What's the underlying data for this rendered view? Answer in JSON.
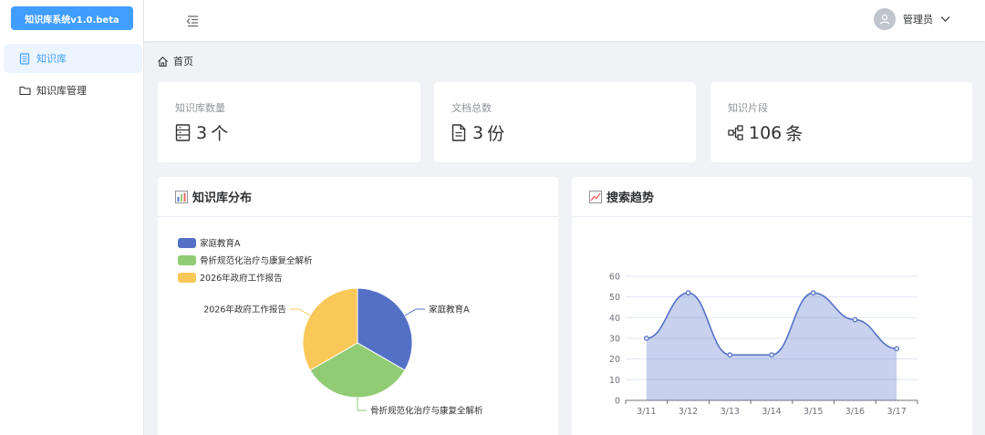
{
  "app": {
    "title": "知识库系统v1.0.beta"
  },
  "sidebar": {
    "items": [
      {
        "label": "知识库",
        "active": true
      },
      {
        "label": "知识库管理",
        "active": false
      }
    ]
  },
  "header": {
    "user_name": "管理员"
  },
  "breadcrumb": {
    "home_label": "首页"
  },
  "stats": [
    {
      "label": "知识库数量",
      "value": "3",
      "unit": "个",
      "icon": "document-list-icon"
    },
    {
      "label": "文档总数",
      "value": "3",
      "unit": "份",
      "icon": "file-text-icon"
    },
    {
      "label": "知识片段",
      "value": "106",
      "unit": "条",
      "icon": "node-tree-icon"
    }
  ],
  "colors": {
    "accent": "#409eff",
    "blue": "#5470c6",
    "green": "#91cc75",
    "yellow": "#fac858"
  },
  "pie_panel": {
    "title": "知识库分布"
  },
  "line_panel": {
    "title": "搜索趋势"
  },
  "chart_data": [
    {
      "type": "pie",
      "title": "知识库分布",
      "legend_position": "top-left",
      "categories": [
        "家庭教育A",
        "骨折规范化治疗与康复全解析",
        "2026年政府工作报告"
      ],
      "values": [
        1,
        1,
        1
      ],
      "colors": [
        "#5470c6",
        "#91cc75",
        "#fac858"
      ]
    },
    {
      "type": "area",
      "title": "搜索趋势",
      "x": [
        "3/11",
        "3/12",
        "3/13",
        "3/14",
        "3/15",
        "3/16",
        "3/17"
      ],
      "y": [
        30,
        52,
        22,
        22,
        52,
        39,
        25
      ],
      "ylim": [
        0,
        60
      ],
      "yticks": [
        0,
        10,
        20,
        30,
        40,
        50,
        60
      ],
      "grid": true,
      "color": "#5470c6"
    }
  ]
}
